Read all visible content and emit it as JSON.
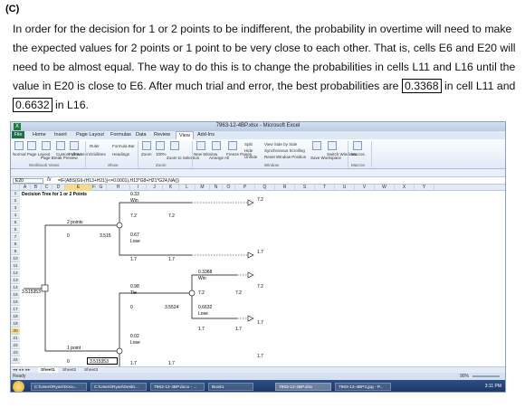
{
  "heading": "(C)",
  "paragraph": {
    "text1": "In order for the decision for 1 or 2 points to be indifferent, the probability in overtime will need to make the expected values for 2 points or 1 point to be very close to each other. That is, cells E6 and E20 will need to be almost equal. The way to do this is to change the probabilities in cells L11 and L16 until the value in E20 is close to E6. After much trial and error, the best probabilities are ",
    "value1": "0.3368",
    "text2": " in cell L11 and ",
    "value2": "0.6632",
    "text3": " in L16."
  },
  "excel": {
    "window_title": "7963-12-4BP.xlsx - Microsoft Excel",
    "tabs": [
      "File",
      "Home",
      "Insert",
      "Page Layout",
      "Formulas",
      "Data",
      "Review",
      "View",
      "Add-Ins"
    ],
    "active_tab": "View",
    "groups": [
      "Workbook Views",
      "Show",
      "Zoom",
      "Window",
      "Macros"
    ],
    "ribbon_labels": {
      "normal": "Normal",
      "page_layout": "Page Layout",
      "page_break": "Page Break Preview",
      "custom_views": "Custom Views",
      "full_screen": "Full Screen",
      "ruler": "Ruler",
      "gridlines": "Gridlines",
      "formula_bar": "Formula Bar",
      "headings": "Headings",
      "zoom": "Zoom",
      "zoom100": "100%",
      "zoom_sel": "Zoom to Selection",
      "new_window": "New Window",
      "arrange_all": "Arrange All",
      "freeze": "Freeze Panes",
      "split": "Split",
      "hide": "Hide",
      "unhide": "Unhide",
      "side_by_side": "View Side by Side",
      "sync_scroll": "Synchronous Scrolling",
      "reset_pos": "Reset Window Position",
      "save_ws": "Save Workspace",
      "switch_win": "Switch Windows",
      "macros": "Macros"
    },
    "name_box": "E20",
    "formula": "=IF(ABS(G9-(H13+H21))<=0.0001),H13*G8+H21*G24,NA())",
    "columns": [
      "A",
      "B",
      "C",
      "D",
      "E",
      "F",
      "G",
      "H",
      "I",
      "J",
      "K",
      "L",
      "M",
      "N",
      "O",
      "P",
      "Q",
      "R",
      "S",
      "T",
      "U",
      "V",
      "W",
      "X",
      "Y"
    ],
    "selected_column": "E",
    "rows": [
      "1",
      "2",
      "3",
      "4",
      "5",
      "6",
      "7",
      "8",
      "9",
      "10",
      "11",
      "12",
      "13",
      "14",
      "15",
      "16",
      "17",
      "18",
      "19",
      "20",
      "21",
      "22",
      "23",
      "24"
    ],
    "selected_row": "20",
    "cells": {
      "title": "Decision Tree for 1 or 2 Points",
      "two_points": "2 points",
      "one_point": "1 point",
      "d6": "0",
      "e6": "3.515",
      "e20": "3.515353",
      "a13": "3.515353",
      "d20": "0",
      "win1_p": "0.33",
      "win1": "Win",
      "h4": "7.2",
      "j4": "7.2",
      "h6": "0.67",
      "lose1": "Lose",
      "h8": "1.7",
      "j8": "1.7",
      "n3": "7.2",
      "n7": "1.7",
      "l11": "0.3368",
      "win2": "Win",
      "tie_p": "0.98",
      "tie": "Tie",
      "j14": "7.2",
      "m14": "7.2",
      "n13": "7.2",
      "g16": "0",
      "k16": "3.5524",
      "l16": "0.6632",
      "lose2": "Lose",
      "j19": "1.7",
      "m19": "1.7",
      "n18": "1.7",
      "h21": "0.02",
      "lose3": "Lose",
      "n23": "1.7",
      "h24": "1.7",
      "j24": "1.7"
    },
    "sheets": [
      "Sheet1",
      "Sheet2",
      "Sheet3"
    ],
    "active_sheet": "Sheet1",
    "status": "Ready",
    "zoom_level": "90%",
    "taskbar": [
      "C:\\Users\\Ryan\\Docu...",
      "C:\\Users\\Ryan\\Deskt...",
      "7963-12-4BP.docx - ...",
      "Book1",
      "7963-12-4BP.xlsx",
      "7963-12-4BP3.jpg - P..."
    ],
    "clock": "3:11 PM"
  }
}
